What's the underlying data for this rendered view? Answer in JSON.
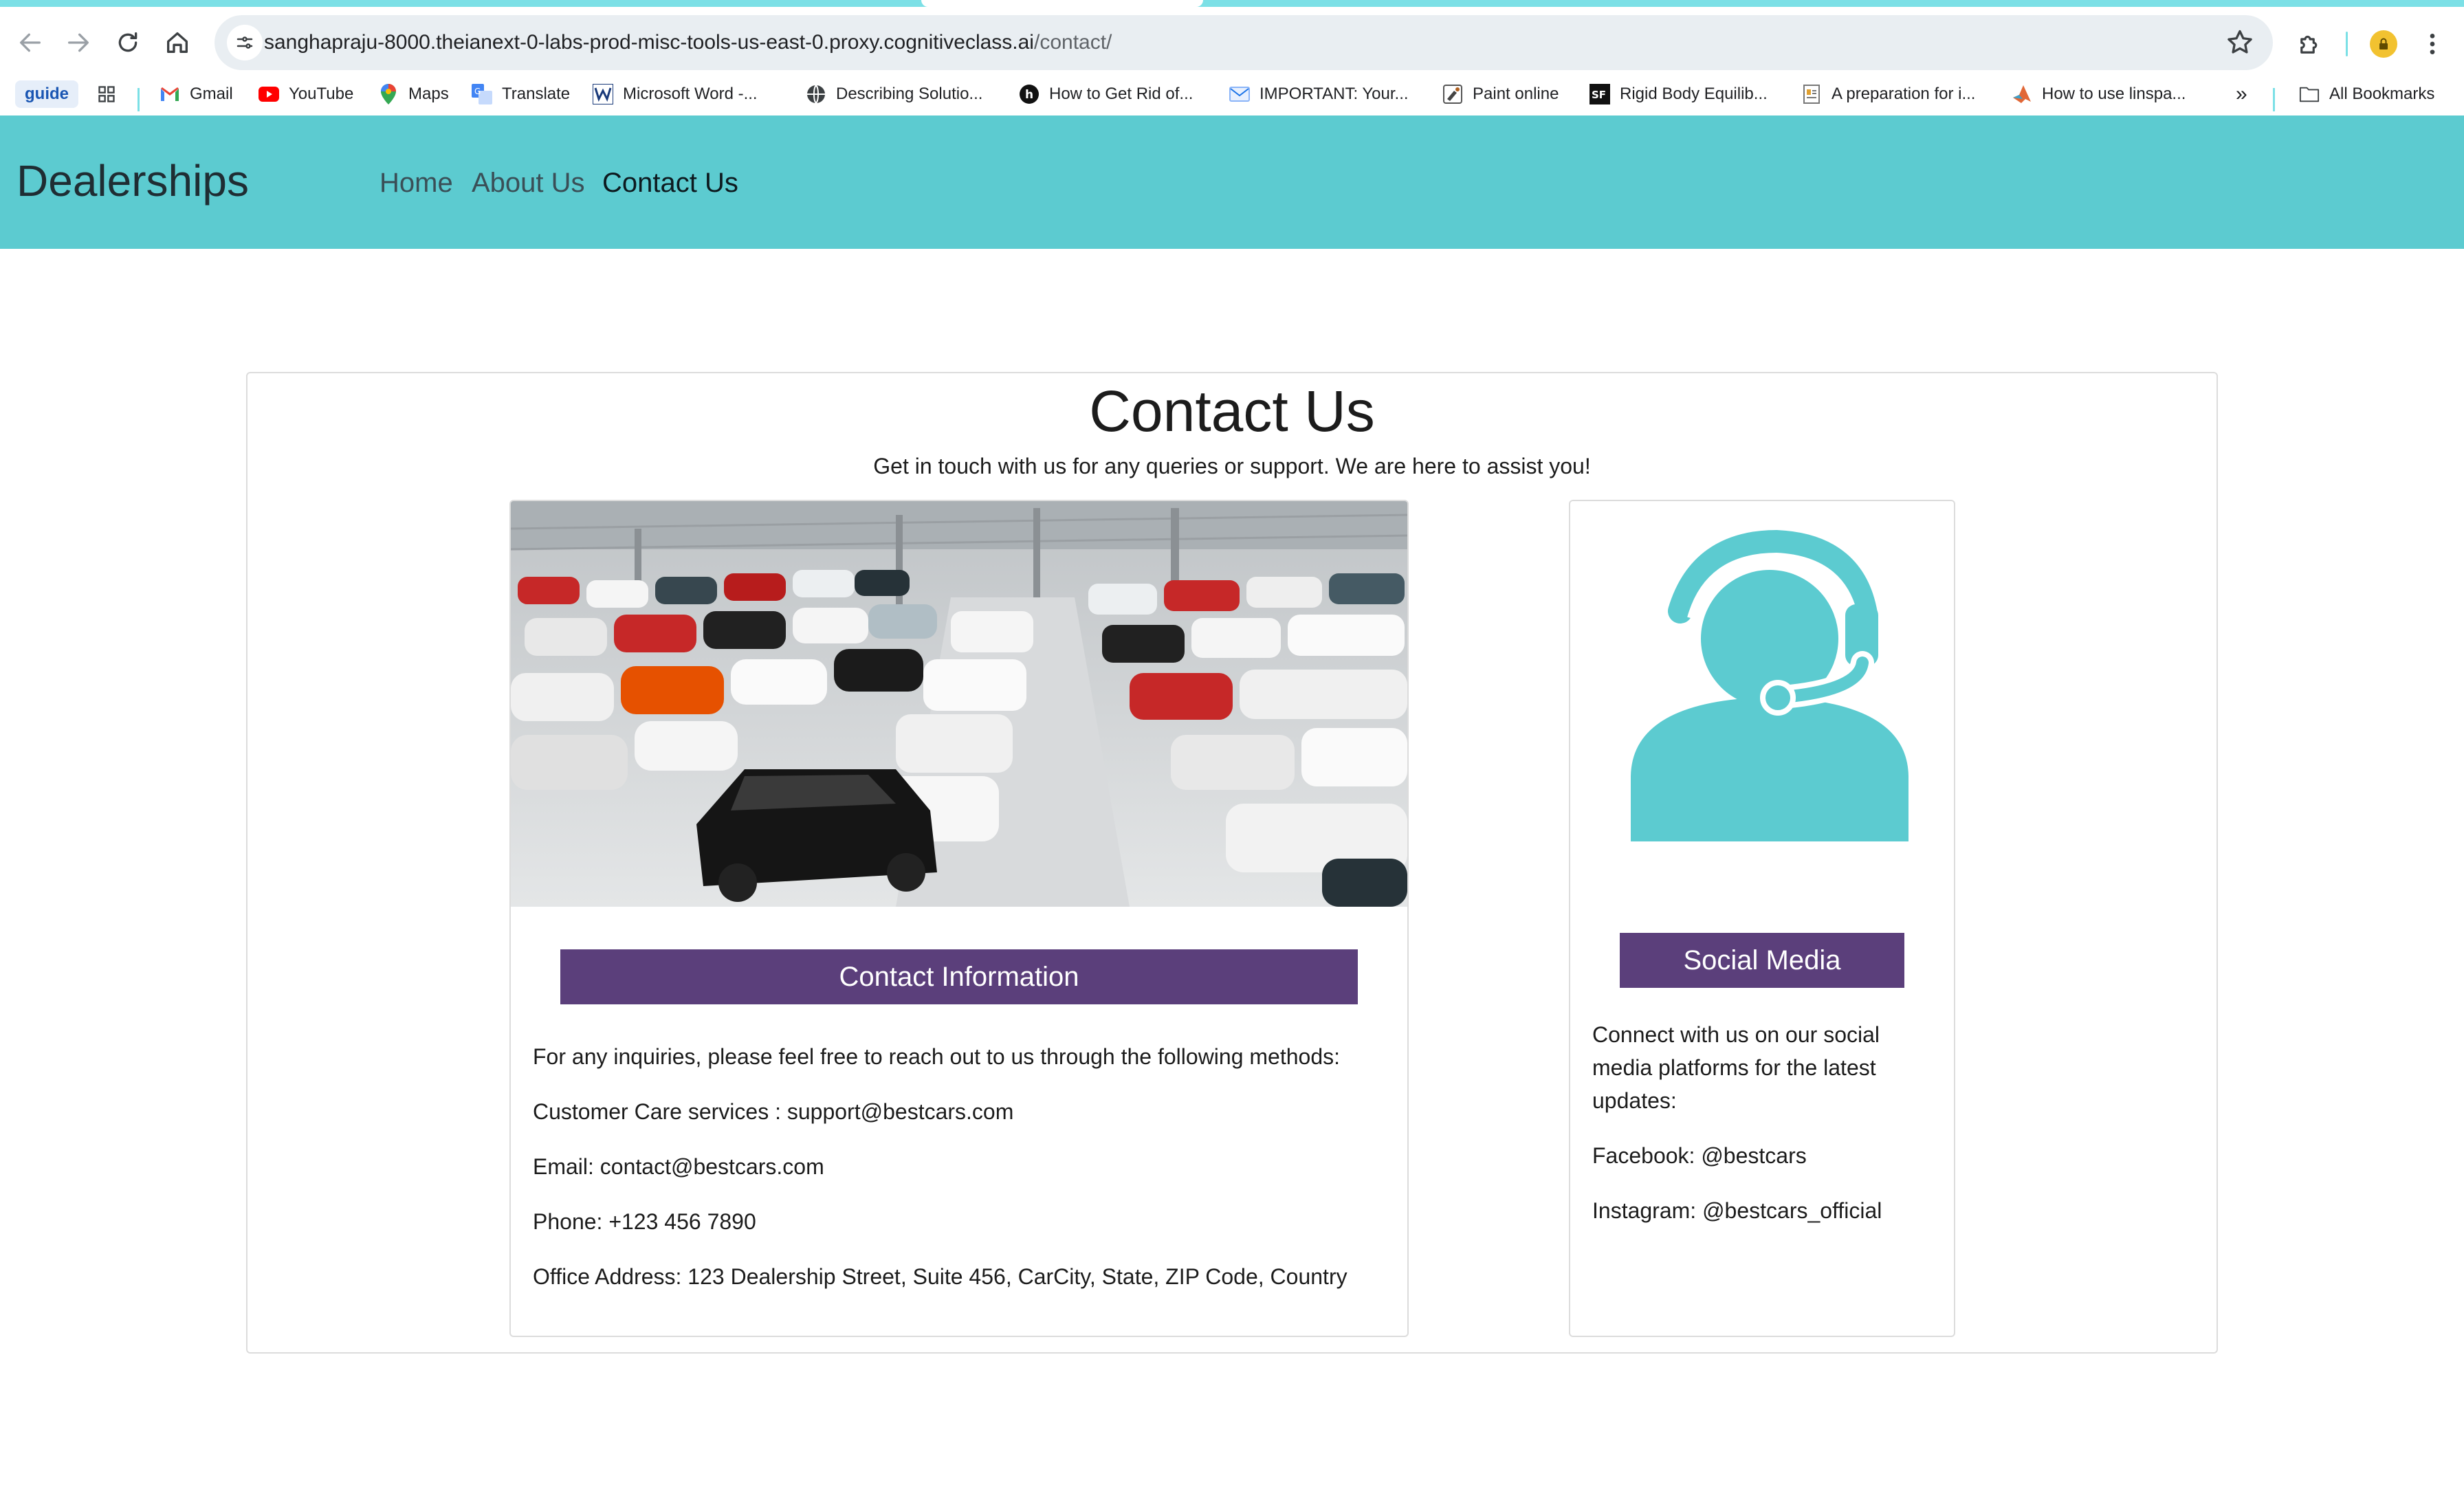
{
  "browser": {
    "url_host": "sanghapraju-8000.theianext-0-labs-prod-misc-tools-us-east-0.proxy.cognitiveclass.ai",
    "url_path": "/contact/",
    "bookmarks": [
      {
        "label": "guide",
        "icon": "guide-badge"
      },
      {
        "label": "Gmail",
        "icon": "gmail-icon"
      },
      {
        "label": "YouTube",
        "icon": "youtube-icon"
      },
      {
        "label": "Maps",
        "icon": "maps-pin-icon"
      },
      {
        "label": "Translate",
        "icon": "translate-icon"
      },
      {
        "label": "Microsoft Word -...",
        "icon": "word-doc-icon"
      },
      {
        "label": "Describing Solutio...",
        "icon": "globe-icon"
      },
      {
        "label": "How to Get Rid of...",
        "icon": "site-icon"
      },
      {
        "label": "IMPORTANT: Your...",
        "icon": "mail-icon"
      },
      {
        "label": "Paint online",
        "icon": "paint-icon"
      },
      {
        "label": "Rigid Body Equilib...",
        "icon": "sf-icon"
      },
      {
        "label": "A preparation for i...",
        "icon": "doc-icon"
      },
      {
        "label": "How to use linspa...",
        "icon": "matlab-icon"
      }
    ],
    "overflow_label": "»",
    "all_bookmarks_label": "All Bookmarks"
  },
  "site": {
    "brand": "Dealerships",
    "nav": [
      {
        "label": "Home",
        "active": false
      },
      {
        "label": "About Us",
        "active": false
      },
      {
        "label": "Contact Us",
        "active": true
      }
    ],
    "accent_color": "#5ccbd0",
    "button_color": "#5b3f7b"
  },
  "page": {
    "title": "Contact Us",
    "subtitle": "Get in touch with us for any queries or support. We are here to assist you!"
  },
  "contact": {
    "heading": "Contact Information",
    "image_alt": "dealership-showroom-photo",
    "lines": [
      "For any inquiries, please feel free to reach out to us through the following methods:",
      "Customer Care services : support@bestcars.com",
      "Email: contact@bestcars.com",
      "Phone: +123 456 7890",
      "Office Address: 123 Dealership Street, Suite 456, CarCity, State, ZIP Code, Country"
    ]
  },
  "social": {
    "heading": "Social Media",
    "icon": "customer-support-icon",
    "intro_lines": [
      "Connect with us on our social",
      "media platforms for the latest",
      "updates:"
    ],
    "facebook": "Facebook: @bestcars",
    "instagram": "Instagram: @bestcars_official"
  }
}
